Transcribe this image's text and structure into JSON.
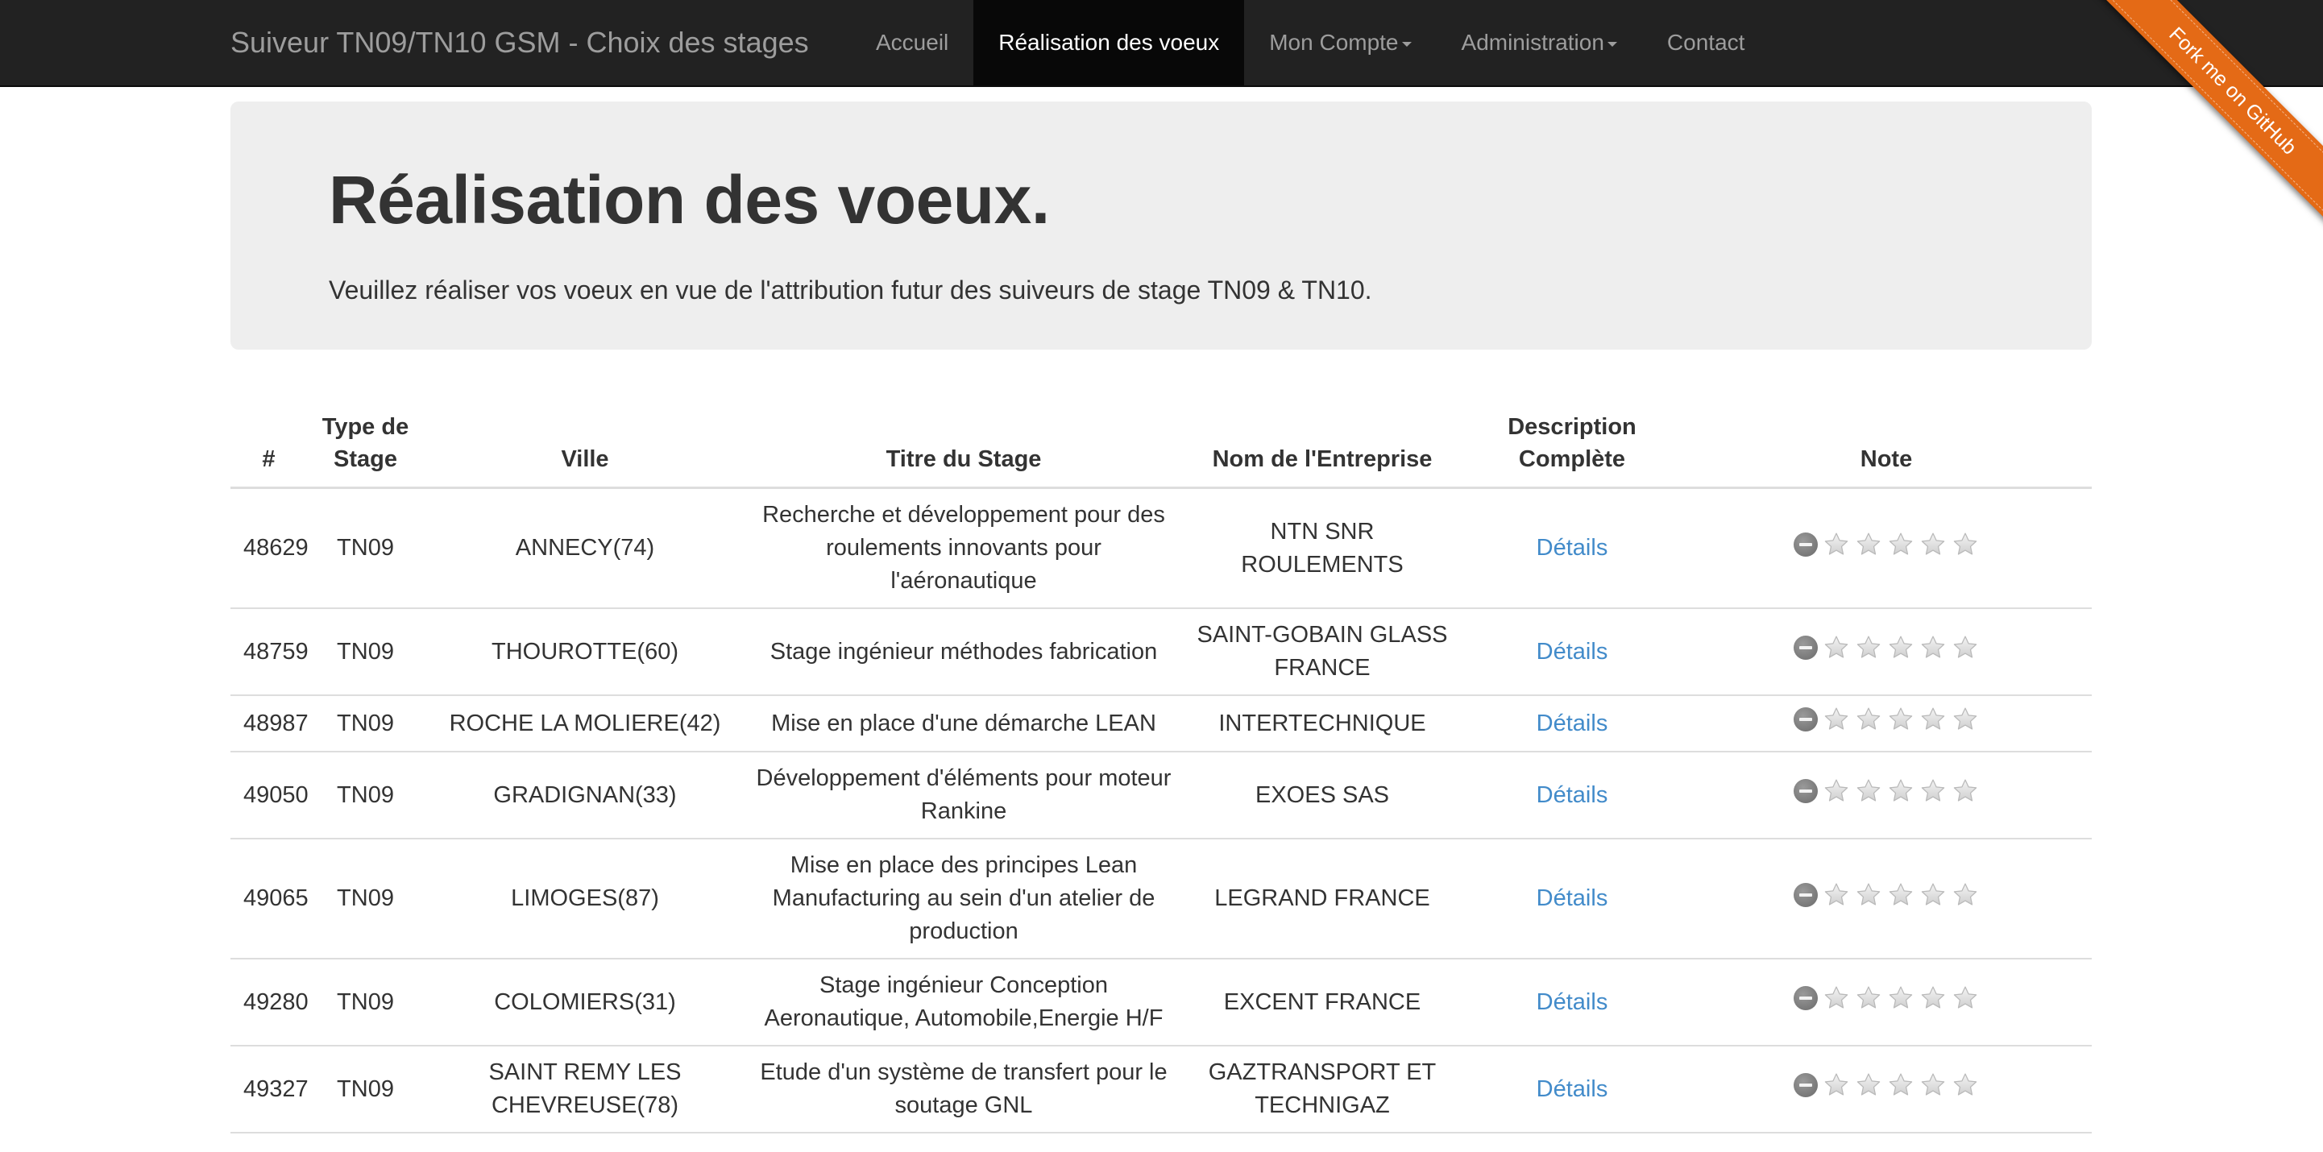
{
  "navbar": {
    "brand": "Suiveur TN09/TN10 GSM - Choix des stages",
    "items": [
      {
        "label": "Accueil",
        "active": false,
        "dropdown": false
      },
      {
        "label": "Réalisation des voeux",
        "active": true,
        "dropdown": false
      },
      {
        "label": "Mon Compte",
        "active": false,
        "dropdown": true
      },
      {
        "label": "Administration",
        "active": false,
        "dropdown": true
      },
      {
        "label": "Contact",
        "active": false,
        "dropdown": false
      }
    ]
  },
  "ribbon": {
    "label": "Fork me on GitHub",
    "color": "#e46a16"
  },
  "jumbotron": {
    "title": "Réalisation des voeux.",
    "text": "Veuillez réaliser vos voeux en vue de l'attribution futur des suiveurs de stage TN09 & TN10."
  },
  "table": {
    "headers": [
      "#",
      "Type de Stage",
      "Ville",
      "Titre du Stage",
      "Nom de l'Entreprise",
      "Description Complète",
      "Note"
    ],
    "rows": [
      {
        "id": "48629",
        "type": "TN09",
        "ville": "ANNECY(74)",
        "titre": "Recherche et développement pour des roulements innovants pour l'aéronautique",
        "entreprise": "NTN SNR ROULEMENTS",
        "details": "Détails",
        "note": 0
      },
      {
        "id": "48759",
        "type": "TN09",
        "ville": "THOUROTTE(60)",
        "titre": "Stage ingénieur méthodes fabrication",
        "entreprise": "SAINT-GOBAIN GLASS FRANCE",
        "details": "Détails",
        "note": 0
      },
      {
        "id": "48987",
        "type": "TN09",
        "ville": "ROCHE LA MOLIERE(42)",
        "titre": "Mise en place d'une démarche LEAN",
        "entreprise": "INTERTECHNIQUE",
        "details": "Détails",
        "note": 0
      },
      {
        "id": "49050",
        "type": "TN09",
        "ville": "GRADIGNAN(33)",
        "titre": "Développement d'éléments pour moteur Rankine",
        "entreprise": "EXOES SAS",
        "details": "Détails",
        "note": 0
      },
      {
        "id": "49065",
        "type": "TN09",
        "ville": "LIMOGES(87)",
        "titre": "Mise en place des principes Lean Manufacturing au sein d'un atelier de production",
        "entreprise": "LEGRAND FRANCE",
        "details": "Détails",
        "note": 0
      },
      {
        "id": "49280",
        "type": "TN09",
        "ville": "COLOMIERS(31)",
        "titre": "Stage ingénieur Conception Aeronautique, Automobile,Energie H/F",
        "entreprise": "EXCENT FRANCE",
        "details": "Détails",
        "note": 0
      },
      {
        "id": "49327",
        "type": "TN09",
        "ville": "SAINT REMY LES CHEVREUSE(78)",
        "titre": "Etude d'un système de transfert pour le soutage GNL",
        "entreprise": "GAZTRANSPORT ET TECHNIGAZ",
        "details": "Détails",
        "note": 0
      }
    ]
  },
  "colors": {
    "navbar_bg": "#222222",
    "nav_active_bg": "#080808",
    "jumbotron_bg": "#eeeeee",
    "link": "#428bca"
  }
}
